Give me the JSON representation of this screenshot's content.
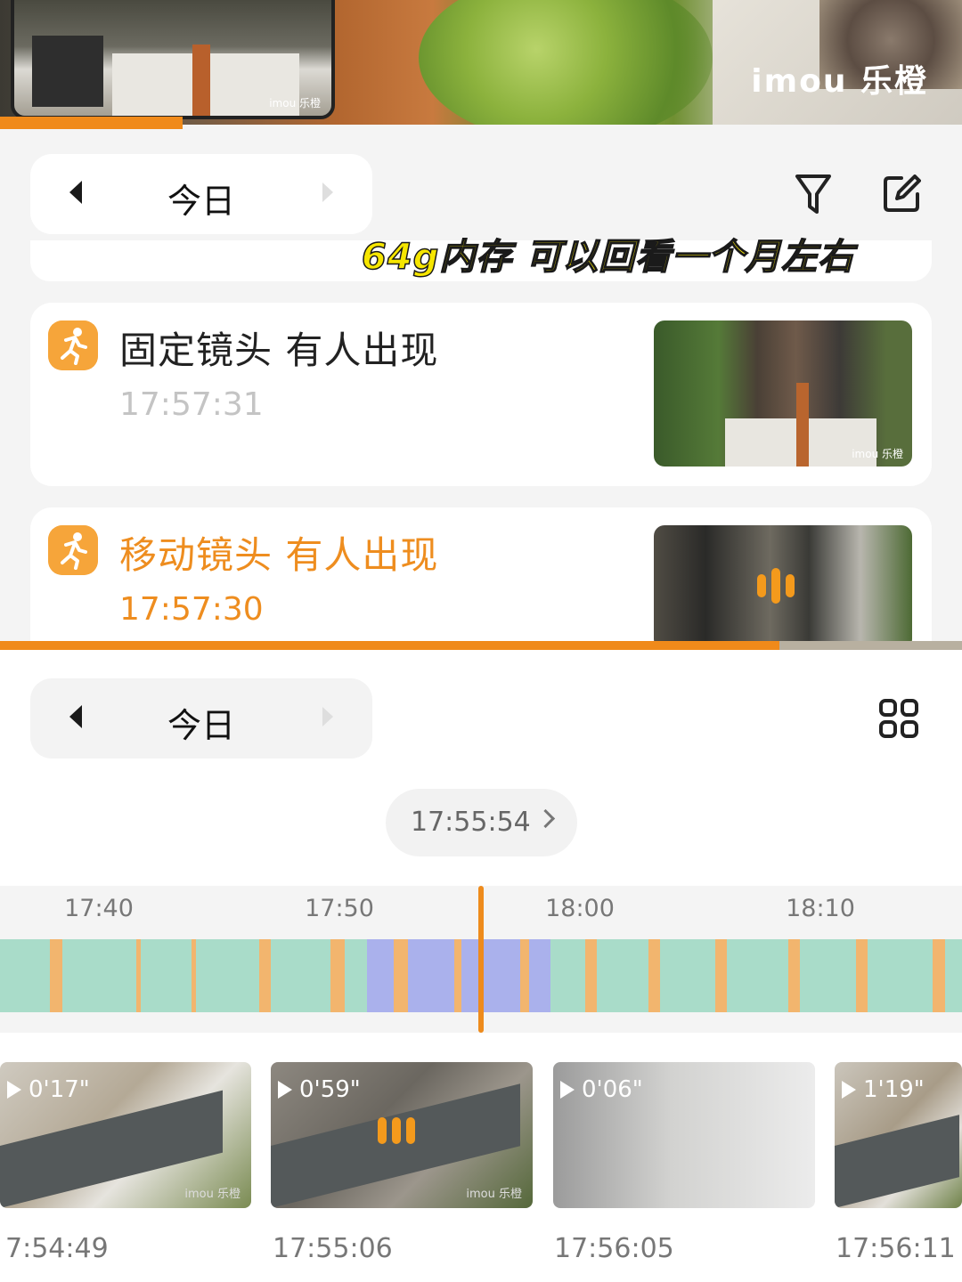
{
  "video": {
    "brand_logo": "imou 乐橙",
    "pip_brand": "imou 乐橙",
    "playback_progress": 0.19
  },
  "top_pane": {
    "date_label": "今日",
    "overlay_caption": "64g内存 可以回看一个月左右",
    "icons": [
      "chevron-left-icon",
      "chevron-right-icon",
      "filter-icon",
      "edit-icon"
    ]
  },
  "events": [
    {
      "title": "固定镜头 有人出现",
      "time": "17:57:31",
      "highlighted": false,
      "thumb_brand": "imou 乐橙"
    },
    {
      "title": "移动镜头 有人出现",
      "time": "17:57:30",
      "highlighted": true,
      "thumb_brand": ""
    }
  ],
  "scroll_progress": 0.81,
  "bottom_pane": {
    "date_label": "今日",
    "current_time": "17:55:54",
    "icons": [
      "chevron-left-icon",
      "chevron-right-icon",
      "grid-view-icon"
    ],
    "timeline": {
      "ticks": [
        "17:40",
        "17:50",
        "18:00",
        "18:10"
      ],
      "cursor_time": "17:55:54",
      "colors": {
        "continuous": "#a9dcc9",
        "motion": "#f2b56e",
        "person": "#aab1ec",
        "cursor": "#ee8b1c"
      }
    },
    "clips": [
      {
        "duration": "0'17\"",
        "time": "7:54:49",
        "brand": "imou 乐橙"
      },
      {
        "duration": "0'59\"",
        "time": "17:55:06",
        "brand": "imou 乐橙"
      },
      {
        "duration": "0'06\"",
        "time": "17:56:05",
        "brand": ""
      },
      {
        "duration": "1'19\"",
        "time": "17:56:11",
        "brand": ""
      }
    ]
  },
  "colors": {
    "accent": "#f08a1a",
    "event_icon": "#f6a53a"
  }
}
